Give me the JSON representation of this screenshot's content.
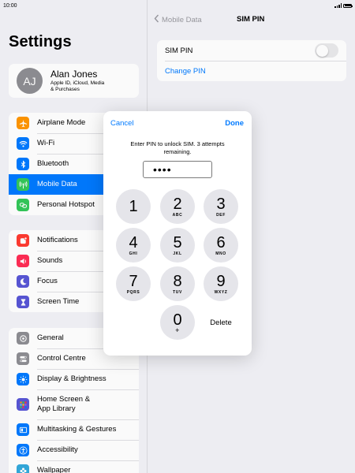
{
  "status_bar": {
    "time": "10:00"
  },
  "sidebar": {
    "title": "Settings",
    "profile": {
      "initials": "AJ",
      "name": "Alan Jones",
      "subtitle_line1": "Apple ID, iCloud, Media",
      "subtitle_line2": "& Purchases"
    },
    "group1": [
      {
        "label": "Airplane Mode",
        "icon": "airplane-icon",
        "color": "#ff9500"
      },
      {
        "label": "Wi-Fi",
        "icon": "wifi-icon",
        "color": "#007aff"
      },
      {
        "label": "Bluetooth",
        "icon": "bluetooth-icon",
        "color": "#007aff"
      },
      {
        "label": "Mobile Data",
        "icon": "antenna-icon",
        "color": "#34c759",
        "selected": true
      },
      {
        "label": "Personal Hotspot",
        "icon": "hotspot-icon",
        "color": "#34c759"
      }
    ],
    "group2": [
      {
        "label": "Notifications",
        "icon": "bell-icon",
        "color": "#ff3b30"
      },
      {
        "label": "Sounds",
        "icon": "speaker-icon",
        "color": "#ff2d55"
      },
      {
        "label": "Focus",
        "icon": "moon-icon",
        "color": "#5856d6"
      },
      {
        "label": "Screen Time",
        "icon": "hourglass-icon",
        "color": "#5856d6"
      }
    ],
    "group3": [
      {
        "label": "General",
        "icon": "gear-icon",
        "color": "#8e8e93"
      },
      {
        "label": "Control Centre",
        "icon": "switches-icon",
        "color": "#8e8e93"
      },
      {
        "label": "Display & Brightness",
        "icon": "sun-icon",
        "color": "#007aff"
      },
      {
        "label_line1": "Home Screen &",
        "label_line2": "App Library",
        "icon": "grid-icon",
        "color": "#5856d6"
      },
      {
        "label": "Multitasking & Gestures",
        "icon": "multitask-icon",
        "color": "#007aff"
      },
      {
        "label": "Accessibility",
        "icon": "accessibility-icon",
        "color": "#007aff"
      },
      {
        "label": "Wallpaper",
        "icon": "flower-icon",
        "color": "#34aadc"
      }
    ]
  },
  "detail": {
    "back_label": "Mobile Data",
    "title": "SIM PIN",
    "sim_pin_label": "SIM PIN",
    "sim_pin_enabled": false,
    "change_pin_label": "Change PIN"
  },
  "dialog": {
    "cancel_label": "Cancel",
    "done_label": "Done",
    "message": "Enter PIN to unlock SIM. 3 attempts remaining.",
    "pin_value": "••••",
    "keys": [
      {
        "num": "1",
        "letters": ""
      },
      {
        "num": "2",
        "letters": "ABC"
      },
      {
        "num": "3",
        "letters": "DEF"
      },
      {
        "num": "4",
        "letters": "GHI"
      },
      {
        "num": "5",
        "letters": "JKL"
      },
      {
        "num": "6",
        "letters": "MNO"
      },
      {
        "num": "7",
        "letters": "PQRS"
      },
      {
        "num": "8",
        "letters": "TUV"
      },
      {
        "num": "9",
        "letters": "WXYZ"
      },
      {
        "num": "0",
        "letters": "+"
      }
    ],
    "delete_label": "Delete"
  }
}
